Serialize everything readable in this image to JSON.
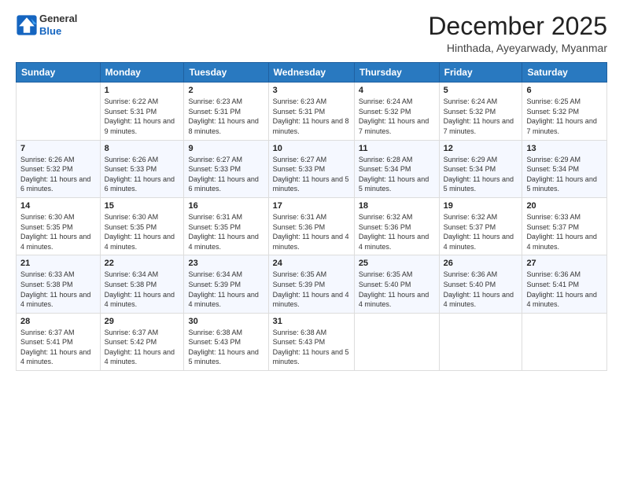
{
  "logo": {
    "line1": "General",
    "line2": "Blue"
  },
  "title": "December 2025",
  "subtitle": "Hinthada, Ayeyarwady, Myanmar",
  "days_header": [
    "Sunday",
    "Monday",
    "Tuesday",
    "Wednesday",
    "Thursday",
    "Friday",
    "Saturday"
  ],
  "weeks": [
    [
      {
        "num": "",
        "sunrise": "",
        "sunset": "",
        "daylight": ""
      },
      {
        "num": "1",
        "sunrise": "Sunrise: 6:22 AM",
        "sunset": "Sunset: 5:31 PM",
        "daylight": "Daylight: 11 hours and 9 minutes."
      },
      {
        "num": "2",
        "sunrise": "Sunrise: 6:23 AM",
        "sunset": "Sunset: 5:31 PM",
        "daylight": "Daylight: 11 hours and 8 minutes."
      },
      {
        "num": "3",
        "sunrise": "Sunrise: 6:23 AM",
        "sunset": "Sunset: 5:31 PM",
        "daylight": "Daylight: 11 hours and 8 minutes."
      },
      {
        "num": "4",
        "sunrise": "Sunrise: 6:24 AM",
        "sunset": "Sunset: 5:32 PM",
        "daylight": "Daylight: 11 hours and 7 minutes."
      },
      {
        "num": "5",
        "sunrise": "Sunrise: 6:24 AM",
        "sunset": "Sunset: 5:32 PM",
        "daylight": "Daylight: 11 hours and 7 minutes."
      },
      {
        "num": "6",
        "sunrise": "Sunrise: 6:25 AM",
        "sunset": "Sunset: 5:32 PM",
        "daylight": "Daylight: 11 hours and 7 minutes."
      }
    ],
    [
      {
        "num": "7",
        "sunrise": "Sunrise: 6:26 AM",
        "sunset": "Sunset: 5:32 PM",
        "daylight": "Daylight: 11 hours and 6 minutes."
      },
      {
        "num": "8",
        "sunrise": "Sunrise: 6:26 AM",
        "sunset": "Sunset: 5:33 PM",
        "daylight": "Daylight: 11 hours and 6 minutes."
      },
      {
        "num": "9",
        "sunrise": "Sunrise: 6:27 AM",
        "sunset": "Sunset: 5:33 PM",
        "daylight": "Daylight: 11 hours and 6 minutes."
      },
      {
        "num": "10",
        "sunrise": "Sunrise: 6:27 AM",
        "sunset": "Sunset: 5:33 PM",
        "daylight": "Daylight: 11 hours and 5 minutes."
      },
      {
        "num": "11",
        "sunrise": "Sunrise: 6:28 AM",
        "sunset": "Sunset: 5:34 PM",
        "daylight": "Daylight: 11 hours and 5 minutes."
      },
      {
        "num": "12",
        "sunrise": "Sunrise: 6:29 AM",
        "sunset": "Sunset: 5:34 PM",
        "daylight": "Daylight: 11 hours and 5 minutes."
      },
      {
        "num": "13",
        "sunrise": "Sunrise: 6:29 AM",
        "sunset": "Sunset: 5:34 PM",
        "daylight": "Daylight: 11 hours and 5 minutes."
      }
    ],
    [
      {
        "num": "14",
        "sunrise": "Sunrise: 6:30 AM",
        "sunset": "Sunset: 5:35 PM",
        "daylight": "Daylight: 11 hours and 4 minutes."
      },
      {
        "num": "15",
        "sunrise": "Sunrise: 6:30 AM",
        "sunset": "Sunset: 5:35 PM",
        "daylight": "Daylight: 11 hours and 4 minutes."
      },
      {
        "num": "16",
        "sunrise": "Sunrise: 6:31 AM",
        "sunset": "Sunset: 5:35 PM",
        "daylight": "Daylight: 11 hours and 4 minutes."
      },
      {
        "num": "17",
        "sunrise": "Sunrise: 6:31 AM",
        "sunset": "Sunset: 5:36 PM",
        "daylight": "Daylight: 11 hours and 4 minutes."
      },
      {
        "num": "18",
        "sunrise": "Sunrise: 6:32 AM",
        "sunset": "Sunset: 5:36 PM",
        "daylight": "Daylight: 11 hours and 4 minutes."
      },
      {
        "num": "19",
        "sunrise": "Sunrise: 6:32 AM",
        "sunset": "Sunset: 5:37 PM",
        "daylight": "Daylight: 11 hours and 4 minutes."
      },
      {
        "num": "20",
        "sunrise": "Sunrise: 6:33 AM",
        "sunset": "Sunset: 5:37 PM",
        "daylight": "Daylight: 11 hours and 4 minutes."
      }
    ],
    [
      {
        "num": "21",
        "sunrise": "Sunrise: 6:33 AM",
        "sunset": "Sunset: 5:38 PM",
        "daylight": "Daylight: 11 hours and 4 minutes."
      },
      {
        "num": "22",
        "sunrise": "Sunrise: 6:34 AM",
        "sunset": "Sunset: 5:38 PM",
        "daylight": "Daylight: 11 hours and 4 minutes."
      },
      {
        "num": "23",
        "sunrise": "Sunrise: 6:34 AM",
        "sunset": "Sunset: 5:39 PM",
        "daylight": "Daylight: 11 hours and 4 minutes."
      },
      {
        "num": "24",
        "sunrise": "Sunrise: 6:35 AM",
        "sunset": "Sunset: 5:39 PM",
        "daylight": "Daylight: 11 hours and 4 minutes."
      },
      {
        "num": "25",
        "sunrise": "Sunrise: 6:35 AM",
        "sunset": "Sunset: 5:40 PM",
        "daylight": "Daylight: 11 hours and 4 minutes."
      },
      {
        "num": "26",
        "sunrise": "Sunrise: 6:36 AM",
        "sunset": "Sunset: 5:40 PM",
        "daylight": "Daylight: 11 hours and 4 minutes."
      },
      {
        "num": "27",
        "sunrise": "Sunrise: 6:36 AM",
        "sunset": "Sunset: 5:41 PM",
        "daylight": "Daylight: 11 hours and 4 minutes."
      }
    ],
    [
      {
        "num": "28",
        "sunrise": "Sunrise: 6:37 AM",
        "sunset": "Sunset: 5:41 PM",
        "daylight": "Daylight: 11 hours and 4 minutes."
      },
      {
        "num": "29",
        "sunrise": "Sunrise: 6:37 AM",
        "sunset": "Sunset: 5:42 PM",
        "daylight": "Daylight: 11 hours and 4 minutes."
      },
      {
        "num": "30",
        "sunrise": "Sunrise: 6:38 AM",
        "sunset": "Sunset: 5:43 PM",
        "daylight": "Daylight: 11 hours and 5 minutes."
      },
      {
        "num": "31",
        "sunrise": "Sunrise: 6:38 AM",
        "sunset": "Sunset: 5:43 PM",
        "daylight": "Daylight: 11 hours and 5 minutes."
      },
      {
        "num": "",
        "sunrise": "",
        "sunset": "",
        "daylight": ""
      },
      {
        "num": "",
        "sunrise": "",
        "sunset": "",
        "daylight": ""
      },
      {
        "num": "",
        "sunrise": "",
        "sunset": "",
        "daylight": ""
      }
    ]
  ]
}
